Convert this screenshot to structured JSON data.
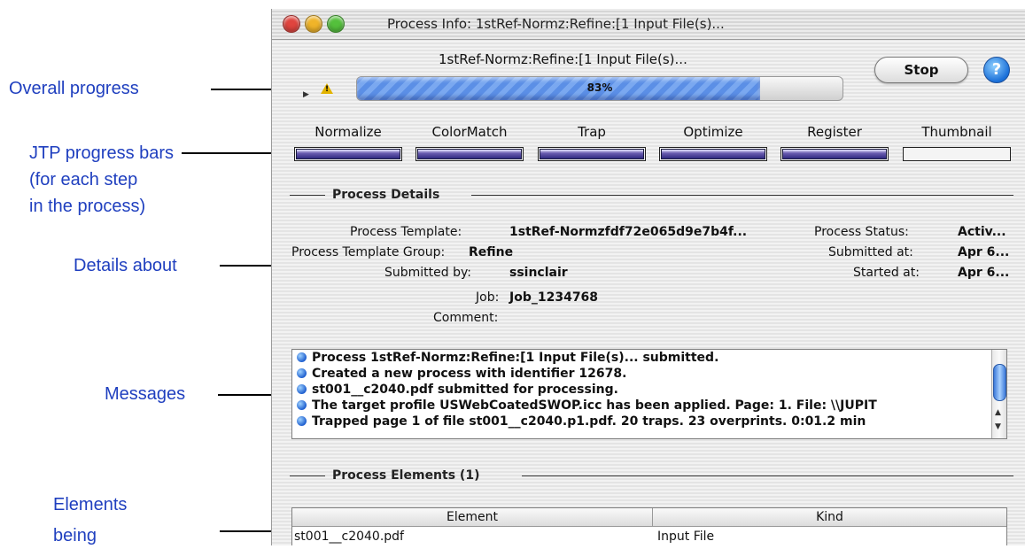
{
  "annotations": {
    "overall": "Overall progress",
    "jtp_line1": "JTP progress bars",
    "jtp_line2": "(for each step",
    "jtp_line3": "in the process)",
    "details": "Details about",
    "messages": "Messages",
    "elements_line1": "Elements",
    "elements_line2": "being"
  },
  "window": {
    "title": "Process Info: 1stRef-Normz:Refine:[1 Input File(s)..."
  },
  "header": {
    "process_name": "1stRef-Normz:Refine:[1 Input File(s)...",
    "stop_label": "Stop",
    "help_label": "?",
    "overall_percent_label": "83%",
    "overall_progress": 0.83
  },
  "steps": [
    {
      "label": "Normalize",
      "progress": 1.0
    },
    {
      "label": "ColorMatch",
      "progress": 1.0
    },
    {
      "label": "Trap",
      "progress": 1.0
    },
    {
      "label": "Optimize",
      "progress": 1.0
    },
    {
      "label": "Register",
      "progress": 1.0
    },
    {
      "label": "Thumbnail",
      "progress": 0.0
    }
  ],
  "details": {
    "group_title": "Process Details",
    "template_label": "Process Template:",
    "template_value": "1stRef-Normzfdf72e065d9e7b4f...",
    "status_label": "Process Status:",
    "status_value": "Activ...",
    "template_group_label": "Process Template Group:",
    "template_group_value": "Refine",
    "submitted_at_label": "Submitted at:",
    "submitted_at_value": "Apr 6...",
    "submitted_by_label": "Submitted by:",
    "submitted_by_value": "ssinclair",
    "started_at_label": "Started at:",
    "started_at_value": "Apr 6...",
    "job_label": "Job:",
    "job_value": "Job_1234768",
    "comment_label": "Comment:"
  },
  "messages": [
    "Process 1stRef-Normz:Refine:[1 Input File(s)... submitted.",
    "Created a new process with identifier 12678.",
    "st001__c2040.pdf submitted for processing.",
    "The target profile USWebCoatedSWOP.icc has been applied. Page: 1. File: \\\\JUPIT",
    "Trapped page 1 of file st001__c2040.p1.pdf. 20 traps. 23 overprints. 0:01.2 min"
  ],
  "elements": {
    "group_title": "Process Elements (1)",
    "columns": [
      "Element",
      "Kind"
    ],
    "rows": [
      {
        "element": "st001__c2040.pdf",
        "kind": "Input File"
      }
    ]
  },
  "colors": {
    "annotation": "#1f3fbf",
    "progress_fill": "#5b8fe6",
    "step_fill": "#2f2a80"
  }
}
